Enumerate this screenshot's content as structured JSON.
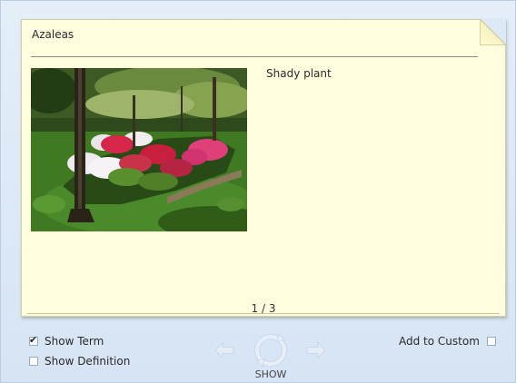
{
  "card": {
    "term": "Azaleas",
    "definition": "Shady plant",
    "pager": "1 / 3"
  },
  "controls": {
    "show_term_label": "Show Term",
    "show_term_checked": true,
    "show_definition_label": "Show Definition",
    "show_definition_checked": false,
    "add_to_custom_label": "Add to Custom",
    "add_to_custom_checked": false,
    "show_label": "SHOW"
  },
  "icons": {
    "prev": "arrow-left-icon",
    "next": "arrow-right-icon",
    "show": "flip-refresh-icon"
  },
  "colors": {
    "card_background": "#fffdde",
    "panel_background": "#dce8f6",
    "nav_icon": "#e2ebf6"
  }
}
